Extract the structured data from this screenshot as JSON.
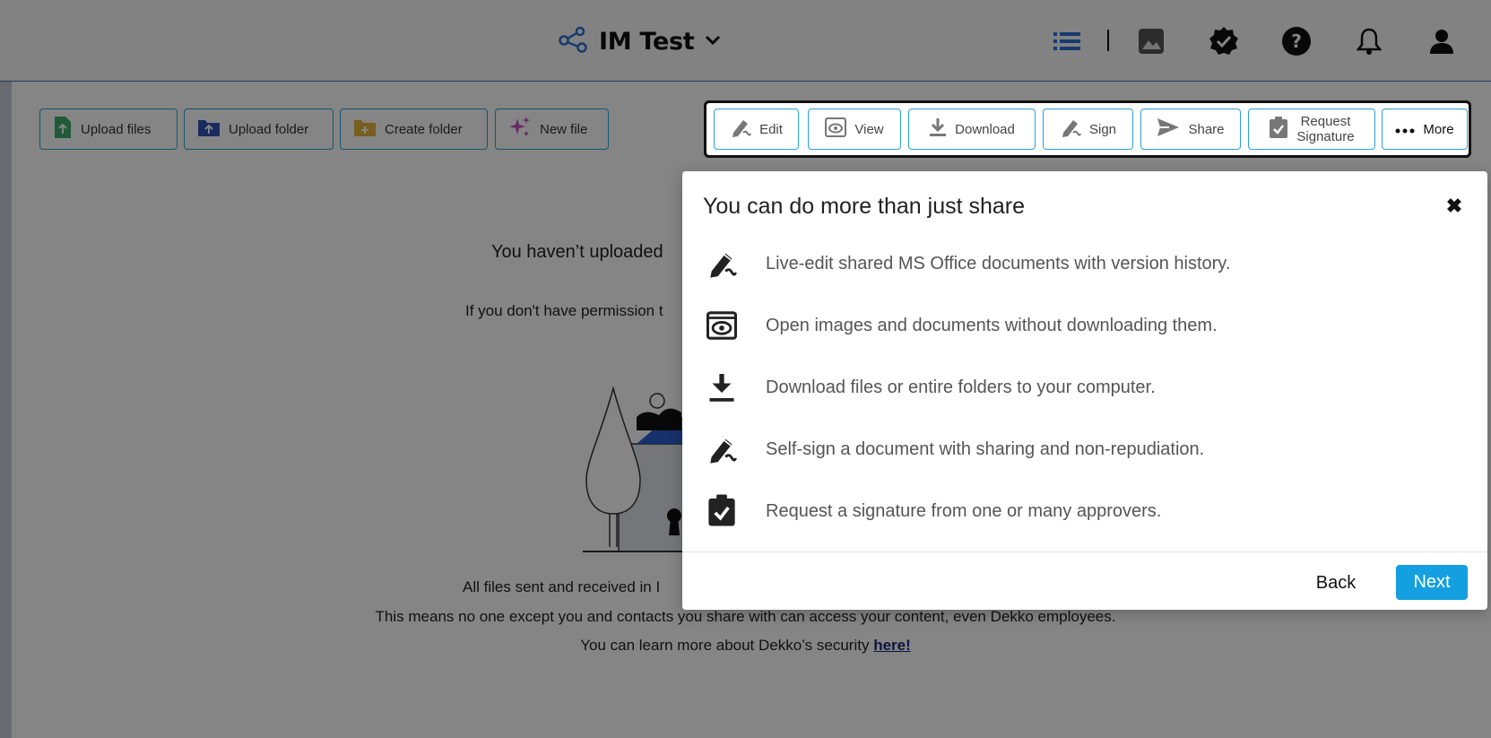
{
  "header": {
    "workspace_name": "IM Test",
    "icons": [
      "workspace-graph-icon",
      "chevron-down-icon",
      "list-view-icon",
      "gallery-view-icon",
      "verified-badge-icon",
      "help-icon",
      "bell-icon",
      "user-icon"
    ]
  },
  "actions": {
    "upload_files": "Upload files",
    "upload_folder": "Upload folder",
    "create_folder": "Create folder",
    "new_file": "New file"
  },
  "toolbar": {
    "edit": "Edit",
    "view": "View",
    "download": "Download",
    "sign": "Sign",
    "share": "Share",
    "request_line1": "Request",
    "request_line2": "Signature",
    "more": "More"
  },
  "empty_state": {
    "title": "You haven’t uploaded",
    "subtitle": "If you don't have permission t",
    "line1": "All files sent and received in I",
    "line2": "This means no one except you and contacts you share with can access your content, even Dekko employees.",
    "line3_prefix": "You can learn more about Dekko’s security ",
    "link": "here!"
  },
  "modal": {
    "title": "You can do more than just share",
    "features": [
      {
        "icon": "edit-pen-icon",
        "text": "Live-edit shared MS Office documents with version history."
      },
      {
        "icon": "eye-icon",
        "text": "Open images and documents without downloading them."
      },
      {
        "icon": "download-icon",
        "text": "Download files or entire folders to your computer."
      },
      {
        "icon": "sign-pen-icon",
        "text": "Self-sign a document with sharing and non-repudiation."
      },
      {
        "icon": "clipboard-check-icon",
        "text": "Request a signature from one or many approvers."
      }
    ],
    "back_label": "Back",
    "next_label": "Next"
  },
  "colors": {
    "accent": "#14a0e0",
    "button_border": "#2aa3d8",
    "header_rule": "#3a6fb3",
    "overlay": "rgba(0,0,0,0.48)"
  }
}
